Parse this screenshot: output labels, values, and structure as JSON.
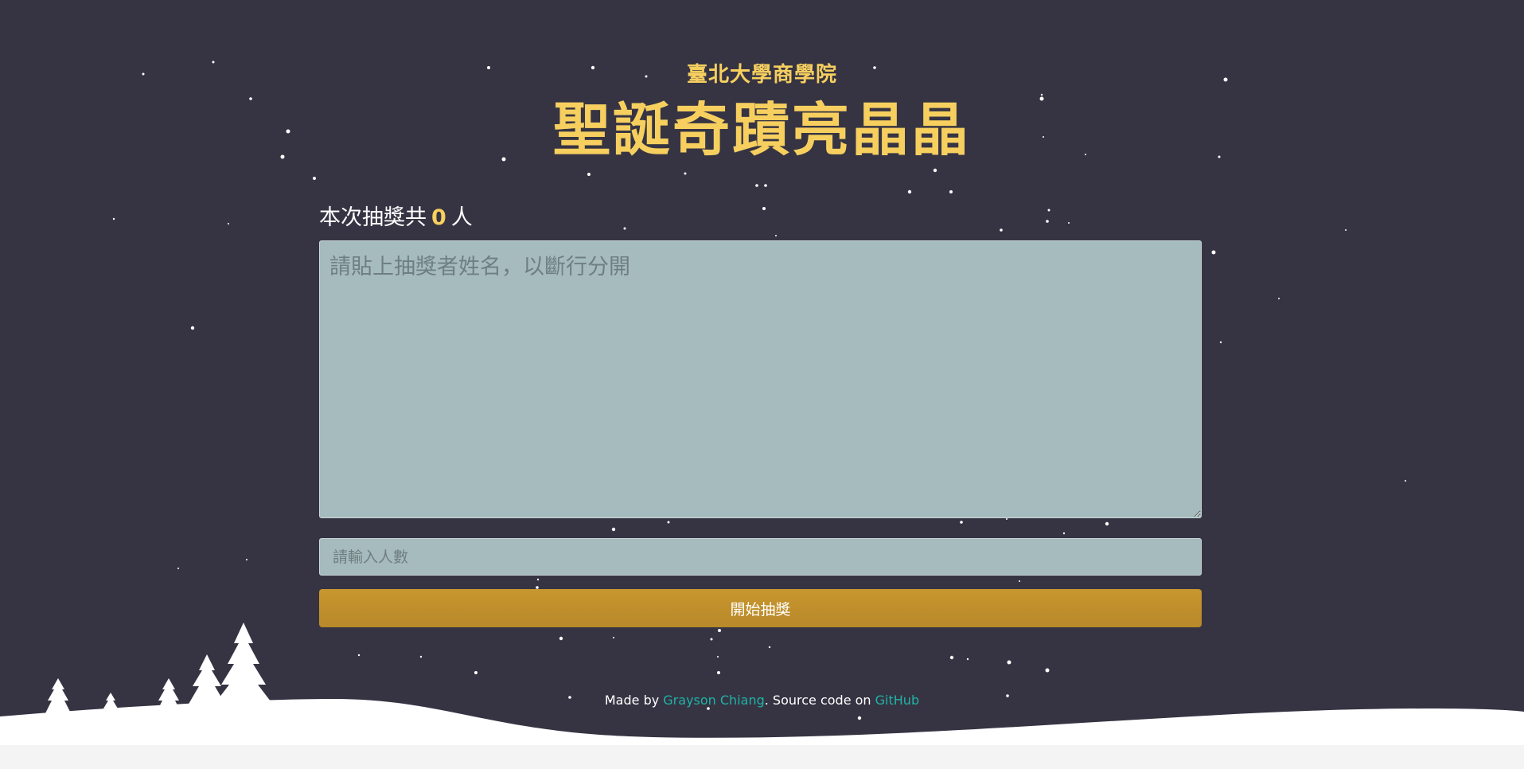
{
  "header": {
    "subtitle": "臺北大學商學院",
    "title": "聖誕奇蹟亮晶晶"
  },
  "counter": {
    "prefix": "本次抽獎共",
    "count": "0",
    "suffix": "人"
  },
  "names_input": {
    "value": "",
    "placeholder": "請貼上抽獎者姓名，以斷行分開"
  },
  "winners_input": {
    "value": "",
    "placeholder": "請輸入人數"
  },
  "start_button": {
    "label": "開始抽獎"
  },
  "footer": {
    "made_by": "Made by ",
    "author_link": "Grayson Chiang",
    "middle": ". Source code on ",
    "repo_link": "GitHub"
  },
  "colors": {
    "background": "#363443",
    "title_gold": "#f6cf5f",
    "input_bg": "#a6bbbd",
    "button_gold": "#c9972e",
    "link_teal": "#20b3a6",
    "snow": "#ffffff"
  },
  "icons": [
    "star-icon",
    "tree-icon"
  ]
}
